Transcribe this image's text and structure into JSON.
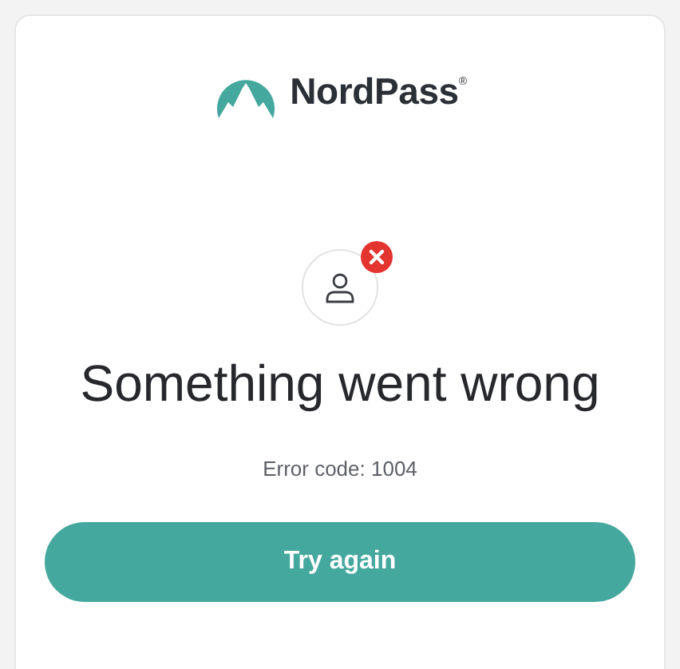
{
  "logo": {
    "name": "NordPass$^{®}$"
  },
  "status": {
    "error": true
  },
  "title": "Something went wrong",
  "error_code": "Error code: 1004",
  "button": {
    "label": "Try again"
  }
}
